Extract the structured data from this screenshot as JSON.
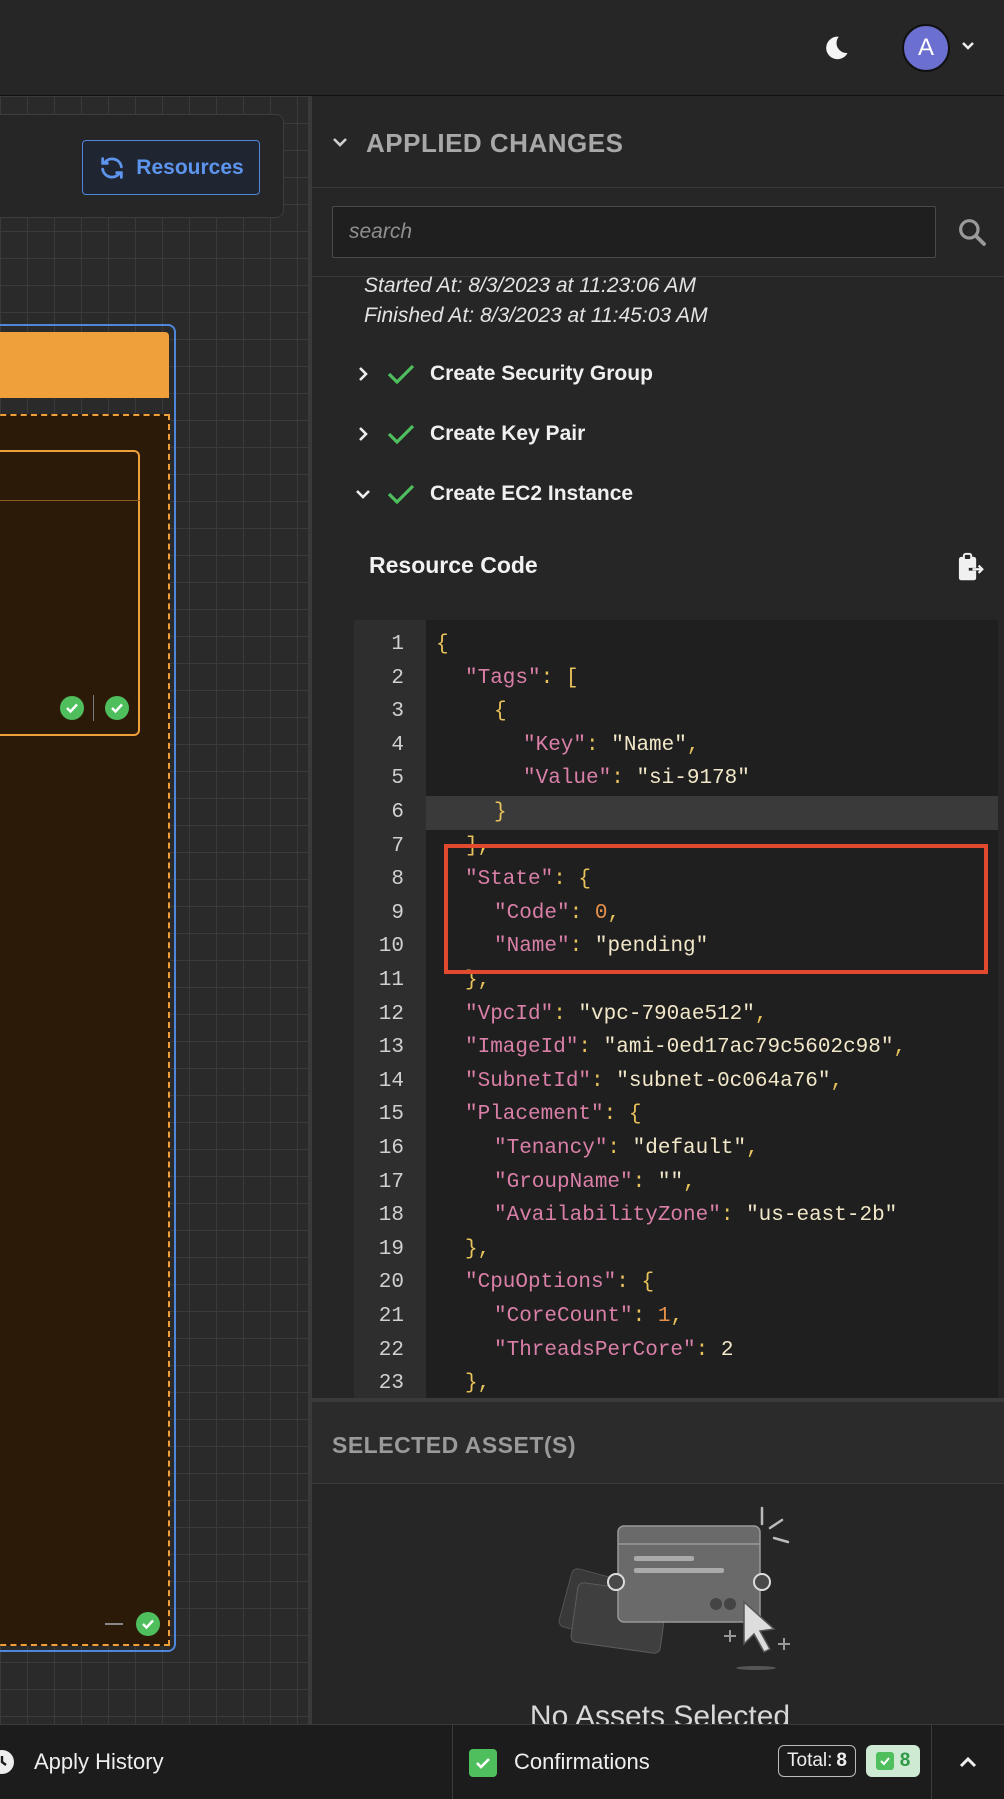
{
  "topbar": {
    "link_icon": "link-icon",
    "theme_icon": "moon-icon",
    "avatar_initial": "A",
    "avatar_menu_icon": "chevron-down-icon"
  },
  "canvas": {
    "resources_label": "Resources",
    "resources_icon": "refresh-icon"
  },
  "applied_changes": {
    "title": "APPLIED CHANGES",
    "search_placeholder": "search",
    "started_at": "Started At: 8/3/2023 at 11:23:06 AM",
    "finished_at": "Finished At: 8/3/2023 at 11:45:03 AM",
    "tasks": [
      {
        "label": "Create Security Group",
        "expanded": false,
        "status": "success"
      },
      {
        "label": "Create Key Pair",
        "expanded": false,
        "status": "success"
      },
      {
        "label": "Create EC2 Instance",
        "expanded": true,
        "status": "success"
      }
    ],
    "resource_code_title": "Resource Code"
  },
  "code_lines": [
    {
      "num": "1"
    },
    {
      "num": "2"
    },
    {
      "num": "3"
    },
    {
      "num": "4"
    },
    {
      "num": "5"
    },
    {
      "num": "6"
    },
    {
      "num": "7"
    },
    {
      "num": "8"
    },
    {
      "num": "9"
    },
    {
      "num": "10"
    },
    {
      "num": "11"
    },
    {
      "num": "12"
    },
    {
      "num": "13"
    },
    {
      "num": "14"
    },
    {
      "num": "15"
    },
    {
      "num": "16"
    },
    {
      "num": "17"
    },
    {
      "num": "18"
    },
    {
      "num": "19"
    },
    {
      "num": "20"
    },
    {
      "num": "21"
    },
    {
      "num": "22"
    },
    {
      "num": "23"
    }
  ],
  "code": {
    "l1": "{",
    "k_tags": "\"Tags\"",
    "l2_tail": ": [",
    "l3": "{",
    "k_key": "\"Key\"",
    "v_key": "\"Name\"",
    "k_value": "\"Value\"",
    "v_value": "\"si-9178\"",
    "l6": "}",
    "l7": "],",
    "k_state": "\"State\"",
    "l8_tail": ": {",
    "k_code": "\"Code\"",
    "v_code": "0",
    "k_name": "\"Name\"",
    "v_name": "\"pending\"",
    "l11": "},",
    "k_vpc": "\"VpcId\"",
    "v_vpc": "\"vpc-790ae512\"",
    "k_image": "\"ImageId\"",
    "v_image": "\"ami-0ed17ac79c5602c98\"",
    "k_subnet": "\"SubnetId\"",
    "v_subnet": "\"subnet-0c064a76\"",
    "k_placement": "\"Placement\"",
    "l15_tail": ": {",
    "k_tenancy": "\"Tenancy\"",
    "v_tenancy": "\"default\"",
    "k_group": "\"GroupName\"",
    "v_group": "\"\"",
    "k_az": "\"AvailabilityZone\"",
    "v_az": "\"us-east-2b\"",
    "l19": "},",
    "k_cpu": "\"CpuOptions\"",
    "l20_tail": ": {",
    "k_core": "\"CoreCount\"",
    "v_core": "1",
    "k_threads": "\"ThreadsPerCore\"",
    "v_threads": "2",
    "l23": "},"
  },
  "selected_assets": {
    "title": "SELECTED ASSET(S)",
    "empty_text": "No Assets Selected"
  },
  "bottombar": {
    "apply_history": "Apply History",
    "confirmations": "Confirmations",
    "total_label": "Total:",
    "total_value": "8",
    "success_value": "8",
    "colors": {
      "success": "#4fbf5d",
      "accent": "#5d95ee",
      "highlight": "#e24a2f"
    }
  }
}
